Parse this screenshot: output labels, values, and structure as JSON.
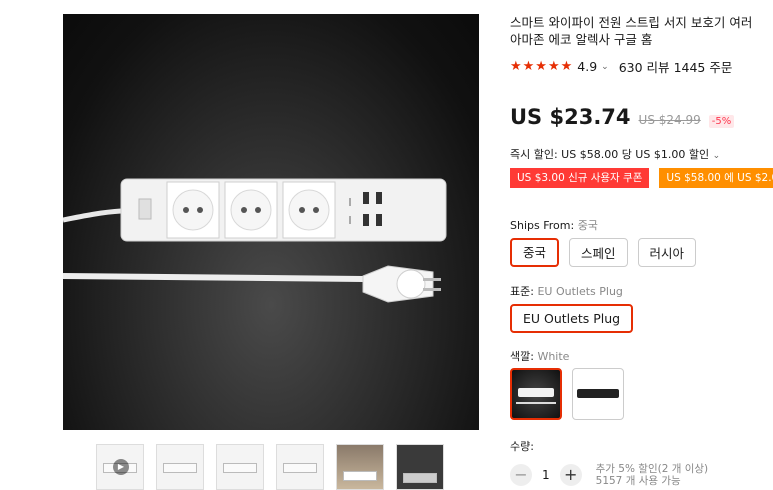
{
  "product": {
    "title_line1": "스마트 와이파이 전원 스트립 서지 보호기 여러",
    "title_line2": "아마존 에코 알렉사 구글 홈",
    "stars": "★★★★★",
    "rating": "4.9",
    "reviews": "630 리뷰",
    "orders": "1445 주문"
  },
  "price": {
    "current": "US $23.74",
    "original": "US $24.99",
    "discount": "-5%",
    "instant_discount": "즉시 할인: US $58.00 당 US $1.00 할인"
  },
  "coupons": [
    {
      "label": "US $3.00 신규 사용자 쿠폰"
    },
    {
      "label": "US $58.00 에 US $2.0"
    }
  ],
  "ships_from": {
    "label": "Ships From:",
    "value": "중국",
    "options": [
      "중국",
      "스페인",
      "러시아"
    ],
    "selected_index": 0
  },
  "standard": {
    "label": "표준:",
    "value": "EU Outlets Plug",
    "options": [
      "EU Outlets Plug"
    ]
  },
  "color": {
    "label": "색깔:",
    "value": "White"
  },
  "quantity": {
    "label": "수량:",
    "value": "1",
    "minus": "−",
    "plus": "+",
    "note_line1": "추가 5% 할인(2 개 이상)",
    "note_line2": "5157 개 사용 가능"
  },
  "thumbnail_play": "▶",
  "accent_color": "#e62e04"
}
